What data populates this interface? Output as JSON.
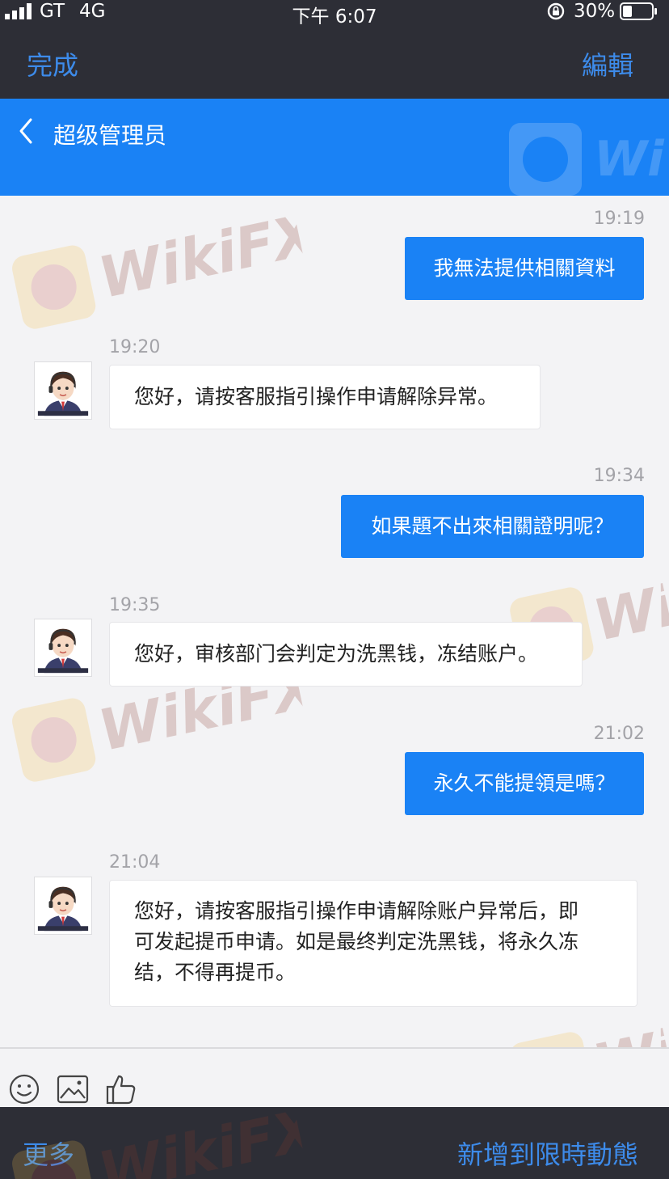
{
  "status_bar": {
    "carrier": "GT",
    "network": "4G",
    "time": "下午 6:07",
    "battery": "30%"
  },
  "top_toolbar": {
    "done_label": "完成",
    "edit_label": "編輯"
  },
  "chat_header": {
    "title": "超级管理员"
  },
  "watermark": "WikiFX",
  "messages": [
    {
      "direction": "outgoing",
      "time": "19:19",
      "text": "我無法提供相關資料"
    },
    {
      "direction": "incoming",
      "time": "19:20",
      "text": "您好，请按客服指引操作申请解除异常。"
    },
    {
      "direction": "outgoing",
      "time": "19:34",
      "text": "如果題不出來相關證明呢？"
    },
    {
      "direction": "incoming",
      "time": "19:35",
      "text": "您好，审核部门会判定为洗黑钱，冻结账户。"
    },
    {
      "direction": "outgoing",
      "time": "21:02",
      "text": "永久不能提領是嗎？"
    },
    {
      "direction": "incoming",
      "time": "21:04",
      "lines": [
        "您好，请按客服指引操作申请解除账户异常后，即",
        "可发起提币申请。如是最终判定洗黑钱，将永久冻",
        "结，不得再提币。"
      ]
    }
  ],
  "input_bar": {
    "icons": [
      "emoji-icon",
      "image-icon",
      "thumbs-up-icon"
    ]
  },
  "bottom_toolbar": {
    "more_label": "更多",
    "add_moment_label": "新增到限時動態"
  },
  "colors": {
    "accent_blue": "#1a82f5",
    "toolbar_dark": "#2d2e36",
    "toolbar_link": "#3d8bea",
    "background": "#f3f3f5"
  }
}
